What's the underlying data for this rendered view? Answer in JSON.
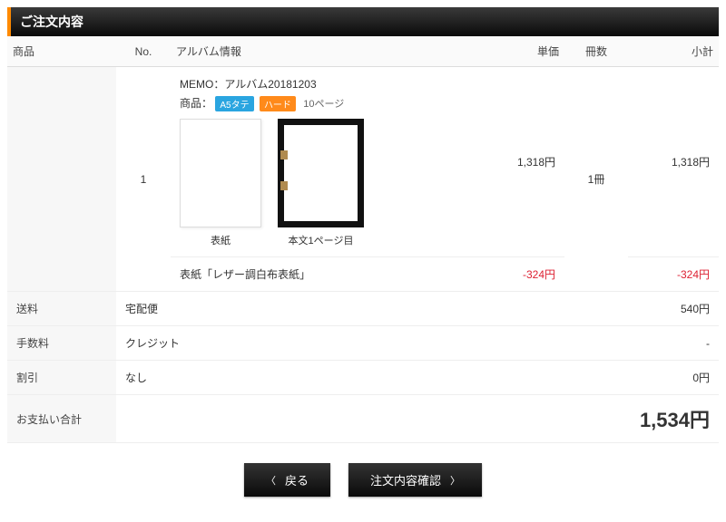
{
  "heading": "ご注文内容",
  "cols": {
    "product": "商品",
    "no": "No.",
    "info": "アルバム情報",
    "price": "単価",
    "qty": "冊数",
    "sub": "小計"
  },
  "item": {
    "no": "1",
    "memo_prefix": "MEMO：",
    "memo_value": "アルバム20181203",
    "spec_prefix": "商品：",
    "badge_size": "A5タテ",
    "badge_type": "ハード",
    "page_count": "10ページ",
    "cover_caption": "表紙",
    "page_caption": "本文1ページ目",
    "unit_price": "1,318円",
    "qty": "1冊",
    "subtotal": "1,318円",
    "discount_label": "表紙「レザー調白布表紙」",
    "discount_price": "-324円",
    "discount_sub": "-324円"
  },
  "rows": {
    "shipping_label": "送料",
    "shipping_method": "宅配便",
    "shipping_value": "540円",
    "fee_label": "手数料",
    "fee_method": "クレジット",
    "fee_value": "-",
    "discount_label": "割引",
    "discount_method": "なし",
    "discount_value": "0円",
    "total_label": "お支払い合計",
    "total_value": "1,534円"
  },
  "buttons": {
    "back": "戻る",
    "confirm": "注文内容確認"
  }
}
